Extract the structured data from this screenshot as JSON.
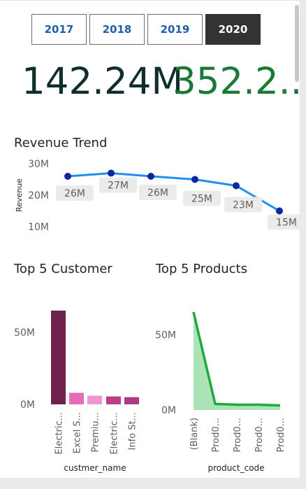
{
  "slicer": {
    "years": [
      "2017",
      "2018",
      "2019",
      "2020"
    ],
    "selected": "2020"
  },
  "kpis": {
    "value_1": "142.24M",
    "value_2": "352.2..."
  },
  "colors": {
    "accent_dark": "#333333",
    "year_text": "#1f5fa8",
    "kpi_1": "#0f2e2e",
    "kpi_2": "#1a7a35",
    "trend_line": "#1f8ef1",
    "trend_point": "#12239e"
  },
  "chart_data": [
    {
      "type": "line",
      "title": "Revenue Trend",
      "xlabel": "",
      "ylabel": "Revenue",
      "y_ticks": [
        "30M",
        "20M",
        "10M"
      ],
      "ylim": [
        10,
        30
      ],
      "values": [
        26,
        27,
        26,
        25,
        23,
        15
      ],
      "data_labels": [
        "26M",
        "27M",
        "26M",
        "25M",
        "23M",
        "15M"
      ],
      "grid": false
    },
    {
      "type": "bar",
      "title": "Top 5 Customer",
      "xlabel": "custmer_name",
      "ylabel": "",
      "y_ticks": [
        "50M",
        "0M"
      ],
      "ylim": [
        0,
        70
      ],
      "categories": [
        "Electric...",
        "Excel S...",
        "Premiu...",
        "Electric...",
        "Info St..."
      ],
      "values": [
        65,
        8,
        6,
        5.5,
        5
      ],
      "colors": [
        "#70224f",
        "#e26eb5",
        "#ef96d0",
        "#bf3c8a",
        "#b03a82"
      ]
    },
    {
      "type": "area",
      "title": "Top 5 Products",
      "xlabel": "product_code",
      "ylabel": "",
      "y_ticks": [
        "50M",
        "0M"
      ],
      "ylim": [
        0,
        70
      ],
      "categories": [
        "(Blank)",
        "Prod0...",
        "Prod0...",
        "Prod0...",
        "Prod0..."
      ],
      "values": [
        65,
        4,
        3.5,
        3.5,
        3
      ]
    }
  ]
}
